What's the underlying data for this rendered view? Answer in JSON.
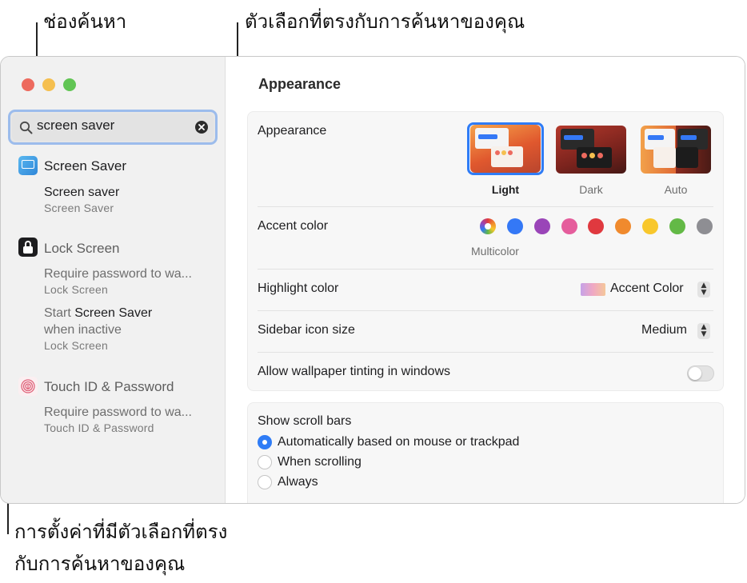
{
  "callouts": {
    "search_field": "ช่องค้นหา",
    "matching_options": "ตัวเลือกที่ตรงกับการค้นหาของคุณ",
    "settings_line1": "การตั้งค่าที่มีตัวเลือกที่ตรง",
    "settings_line2": "กับการค้นหาของคุณ"
  },
  "search": {
    "value": "screen saver",
    "icon": "magnifier-icon",
    "clear_icon": "clear-x-icon"
  },
  "results": [
    {
      "title": "Screen Saver",
      "icon": "screen-saver-icon",
      "items": [
        {
          "title": "Screen saver",
          "caption": "Screen Saver"
        }
      ]
    },
    {
      "title": "Lock Screen",
      "icon": "lock-icon",
      "items": [
        {
          "title": "Require password to wa...",
          "caption": "Lock Screen"
        },
        {
          "title_prefix": "Start ",
          "title_highlight": "Screen Saver",
          "title_line2": "when inactive",
          "caption": "Lock Screen"
        }
      ]
    },
    {
      "title": "Touch ID & Password",
      "icon": "fingerprint-icon",
      "items": [
        {
          "title": "Require password to wa...",
          "caption": "Touch ID & Password"
        }
      ]
    }
  ],
  "main": {
    "title": "Appearance",
    "appearance": {
      "label": "Appearance",
      "options": [
        "Light",
        "Dark",
        "Auto"
      ],
      "selected": "Light"
    },
    "accent": {
      "label": "Accent color",
      "caption": "Multicolor",
      "colors": [
        "#3478f6",
        "#9a45b8",
        "#e55d9c",
        "#e0393f",
        "#f08a2d",
        "#f8c72c",
        "#63b946",
        "#8e8e93"
      ]
    },
    "highlight": {
      "label": "Highlight color",
      "value": "Accent Color"
    },
    "sidebar_icon": {
      "label": "Sidebar icon size",
      "value": "Medium"
    },
    "tinting": {
      "label": "Allow wallpaper tinting in windows",
      "enabled": false
    },
    "scroll": {
      "label": "Show scroll bars",
      "options": [
        "Automatically based on mouse or trackpad",
        "When scrolling",
        "Always"
      ],
      "selected": "Automatically based on mouse or trackpad"
    }
  },
  "colors": {
    "accent": "#2f7cf6",
    "close": "#ed6a5e",
    "minimize": "#f5bf4f",
    "zoom": "#61c554"
  }
}
